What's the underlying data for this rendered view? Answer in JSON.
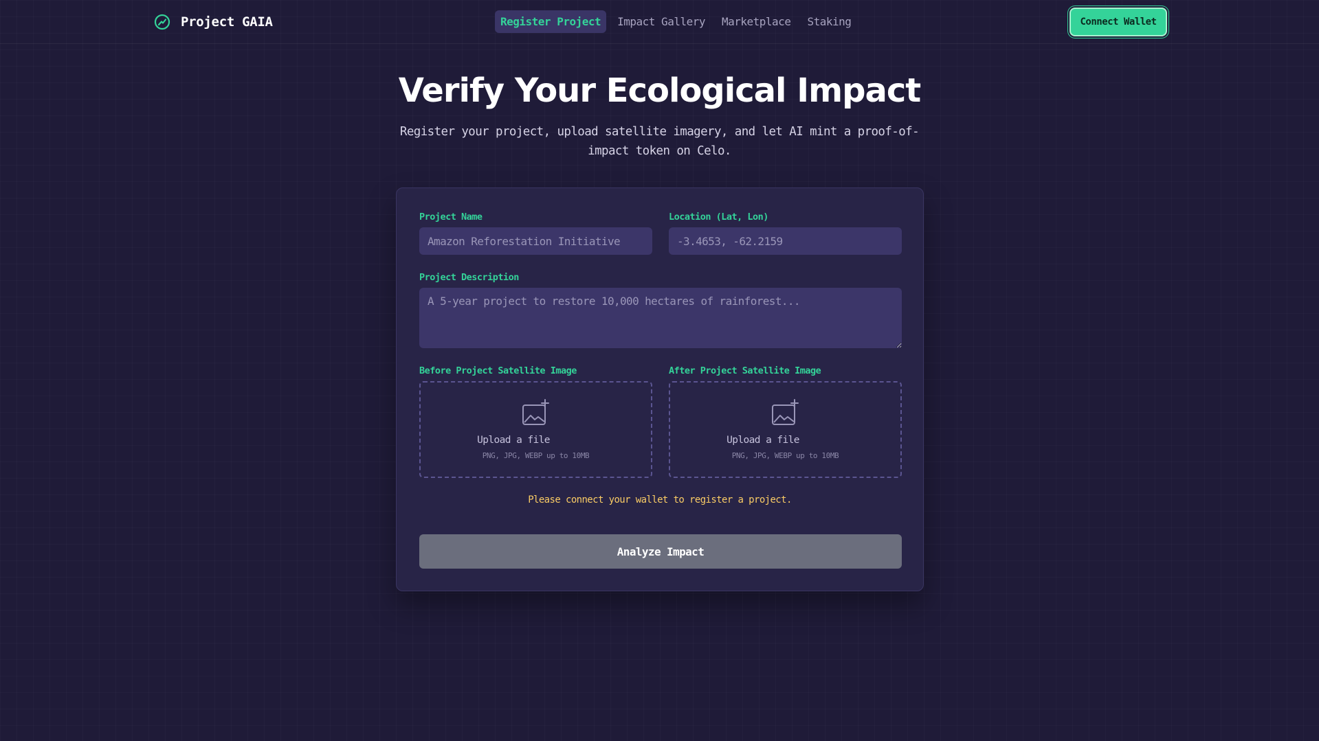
{
  "header": {
    "brand_name": "Project GAIA",
    "brand_icon": "trend-leaf-icon",
    "nav": [
      {
        "label": "Register Project",
        "active": true
      },
      {
        "label": "Impact Gallery",
        "active": false
      },
      {
        "label": "Marketplace",
        "active": false
      },
      {
        "label": "Staking",
        "active": false
      }
    ],
    "connect_label": "Connect Wallet"
  },
  "hero": {
    "title": "Verify Your Ecological Impact",
    "subtitle": "Register your project, upload satellite imagery, and let AI mint a proof-of-impact token on Celo."
  },
  "form": {
    "project_name": {
      "label": "Project Name",
      "placeholder": "Amazon Reforestation Initiative",
      "value": ""
    },
    "location": {
      "label": "Location (Lat, Lon)",
      "placeholder": "-3.4653, -62.2159",
      "value": ""
    },
    "description": {
      "label": "Project Description",
      "placeholder": "A 5-year project to restore 10,000 hectares of rainforest...",
      "value": ""
    },
    "before_image": {
      "label": "Before Project Satellite Image",
      "upload_text": "Upload a file",
      "hint": "PNG, JPG, WEBP up to 10MB",
      "icon": "image-plus-icon"
    },
    "after_image": {
      "label": "After Project Satellite Image",
      "upload_text": "Upload a file",
      "hint": "PNG, JPG, WEBP up to 10MB",
      "icon": "image-plus-icon"
    },
    "warning": "Please connect your wallet to register a project.",
    "submit_label": "Analyze Impact"
  },
  "colors": {
    "accent": "#34d399",
    "background": "#1f1b38",
    "card": "#282447",
    "input": "#3c3669",
    "warning": "#facc65",
    "disabled_button": "#6b6e7d"
  }
}
